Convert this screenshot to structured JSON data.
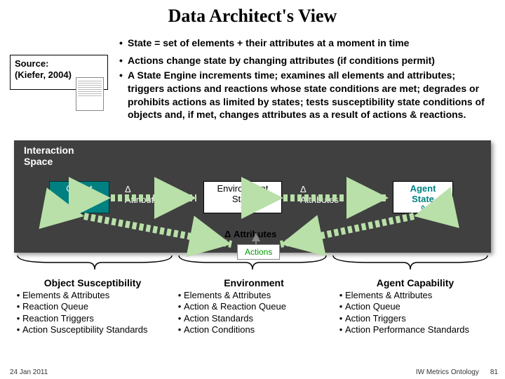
{
  "title": "Data Architect's View",
  "bullets": {
    "b1": "State = set of elements + their attributes at a moment in time",
    "b2": "Actions change state by changing attributes (if conditions permit)",
    "b3": "A State Engine increments time; examines all elements and attributes; triggers actions and reactions whose state conditions are met; degrades or prohibits actions as limited by states; tests susceptibility state conditions of objects and, if met, changes attributes as a result of actions & reactions."
  },
  "source": {
    "label": "Source:",
    "ref": "(Kiefer, 2004)"
  },
  "ispace": "Interaction\nSpace",
  "boxes": {
    "object": "Object\nState",
    "env": "Environment\nState",
    "agent": "Agent\nState",
    "delta_attr": "Δ\nAttributes",
    "delta_attr_inline": "Δ Attributes",
    "actions": "Actions"
  },
  "cols": {
    "obj": {
      "title": "Object Susceptibility",
      "items": [
        "Elements & Attributes",
        "Reaction Queue",
        "Reaction Triggers",
        "Action Susceptibility Standards"
      ]
    },
    "env": {
      "title": "Environment",
      "items": [
        "Elements & Attributes",
        "Action & Reaction Queue",
        "Action Standards",
        "Action Conditions"
      ]
    },
    "agent": {
      "title": "Agent Capability",
      "items": [
        "Elements & Attributes",
        "Action Queue",
        "Action Triggers",
        "Action Performance Standards"
      ]
    }
  },
  "footer": {
    "date": "24 Jan 2011",
    "proj": "IW Metrics Ontology",
    "page": "81"
  }
}
